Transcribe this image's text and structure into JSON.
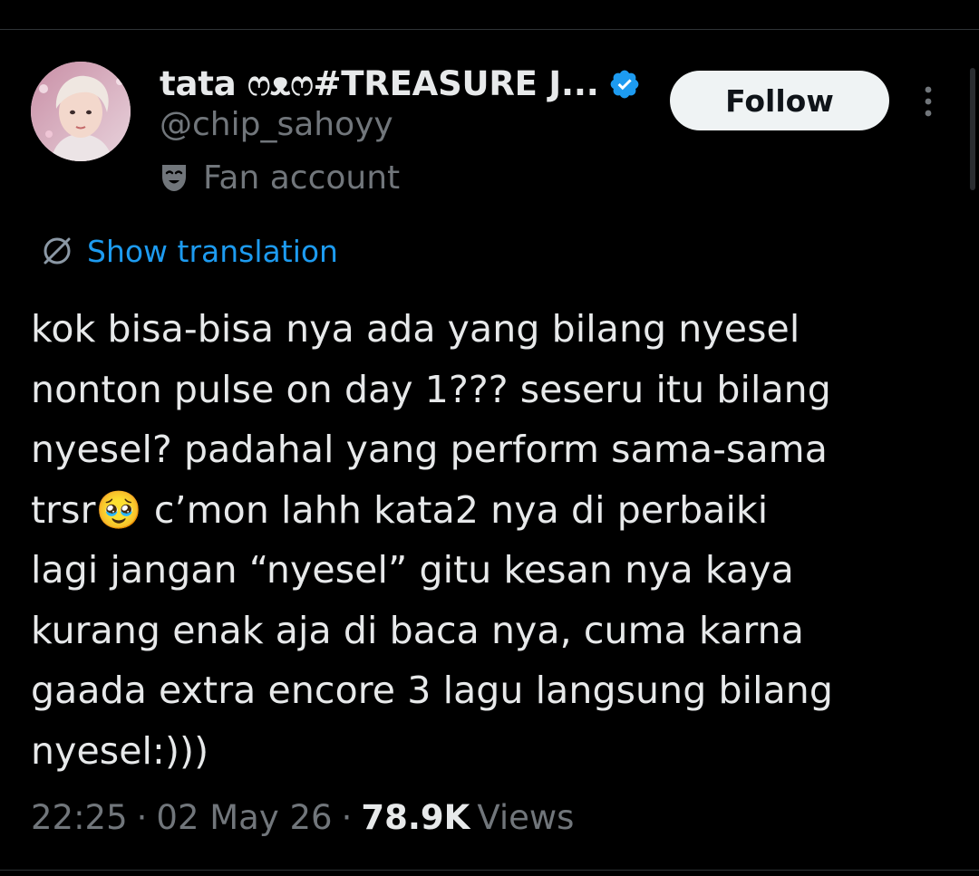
{
  "author": {
    "display_name": "tata ෆ⁠ᴥෆ#TREASURE J...",
    "handle": "@chip_sahoyy",
    "account_label": "Fan account",
    "verified": true
  },
  "actions": {
    "follow_label": "Follow"
  },
  "translation": {
    "label": "Show translation"
  },
  "tweet": {
    "text": "kok bisa-bisa nya ada yang bilang nyesel\nnonton pulse on day 1??? seseru itu bilang\nnyesel? padahal yang perform sama-sama\ntrsr🥹 c’mon lahh kata2 nya di perbaiki\nlagi jangan “nyesel” gitu kesan nya kaya\nkurang enak aja di baca nya, cuma karna\ngaada extra encore 3 lagu langsung bilang\nnyesel:)))"
  },
  "meta": {
    "time": "22:25",
    "separator": "·",
    "date": "02 May 26",
    "views_count": "78.9K",
    "views_label": "Views"
  },
  "colors": {
    "background": "#000000",
    "text": "#e7e9ea",
    "muted": "#71767b",
    "accent": "#1d9bf0",
    "follow_bg": "#eff3f4"
  },
  "icons": {
    "verified": "verified-badge-icon",
    "account_type": "mask-icon",
    "translate": "globe-icon",
    "more": "more-vertical-icon"
  }
}
